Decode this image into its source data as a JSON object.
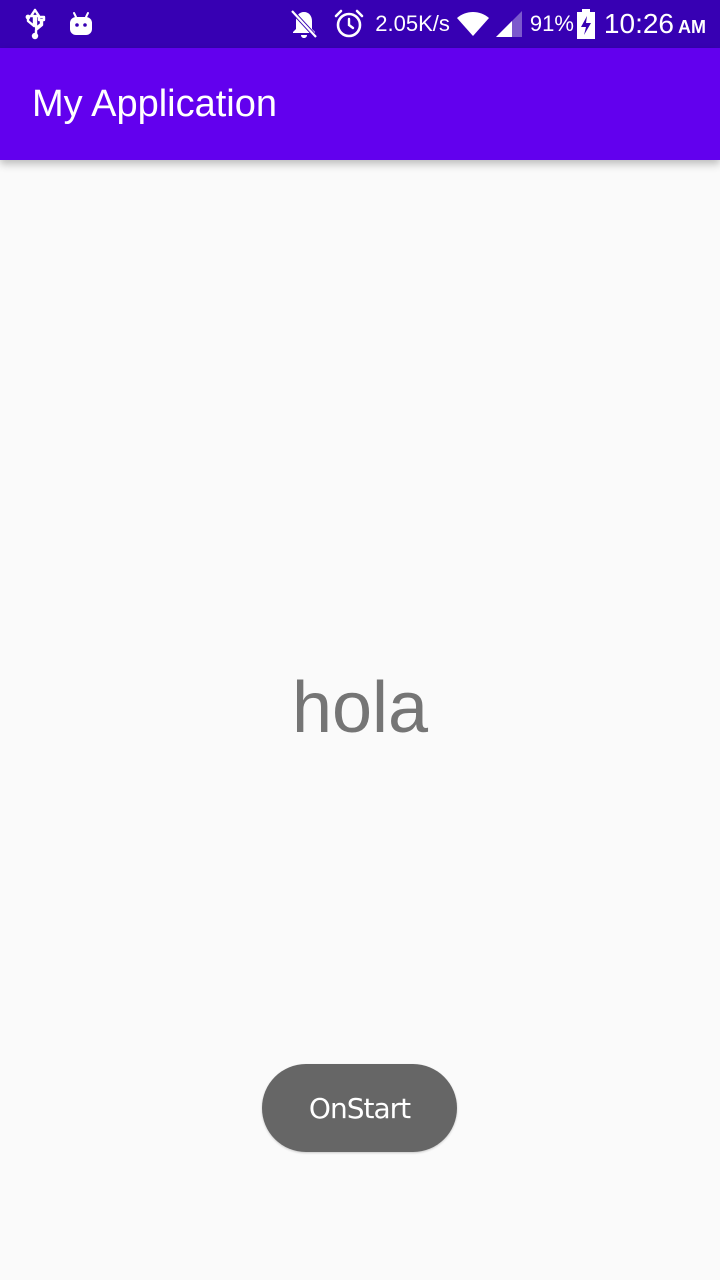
{
  "status_bar": {
    "icons_left": [
      "usb-icon",
      "android-icon"
    ],
    "icons_right": [
      "notifications-off-icon",
      "alarm-icon",
      "wifi-icon",
      "signal-icon",
      "battery-charging-icon"
    ],
    "network_speed": "2.05K/s",
    "battery_percent": "91%",
    "time": "10:26",
    "ampm": "AM",
    "background_color": "#3700b3"
  },
  "app_bar": {
    "title": "My Application",
    "background_color": "#6200ee"
  },
  "main": {
    "text": "hola",
    "button_label": "OnStart",
    "text_color": "#757575",
    "button_color": "#666666"
  }
}
